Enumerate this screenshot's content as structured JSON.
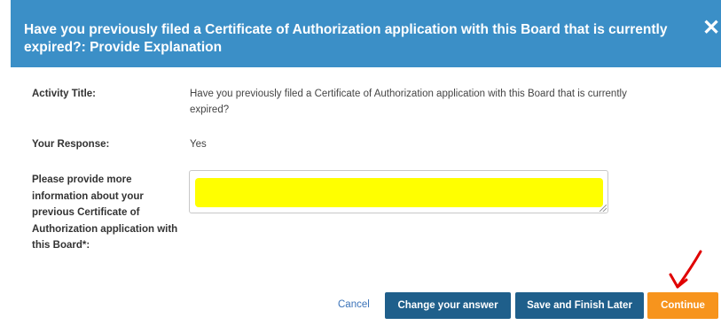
{
  "dialog": {
    "title": "Have you previously filed a Certificate of Authorization application with this Board that is currently expired?: Provide Explanation",
    "close_icon": "close-icon"
  },
  "fields": {
    "activity_title_label": "Activity Title:",
    "activity_title_value": "Have you previously filed a Certificate of Authorization application with this Board that is currently expired?",
    "response_label": "Your Response:",
    "response_value": "Yes",
    "info_label": "Please provide more information about your previous Certificate of Authorization application with this Board*:",
    "info_value": ""
  },
  "actions": {
    "cancel": "Cancel",
    "change_answer": "Change your answer",
    "save_later": "Save and Finish Later",
    "continue": "Continue"
  },
  "colors": {
    "header": "#3b8fc7",
    "primary_button": "#1f5f8b",
    "continue_button": "#f7941d",
    "highlight": "#ffff00",
    "annotation_arrow": "#e00000"
  }
}
